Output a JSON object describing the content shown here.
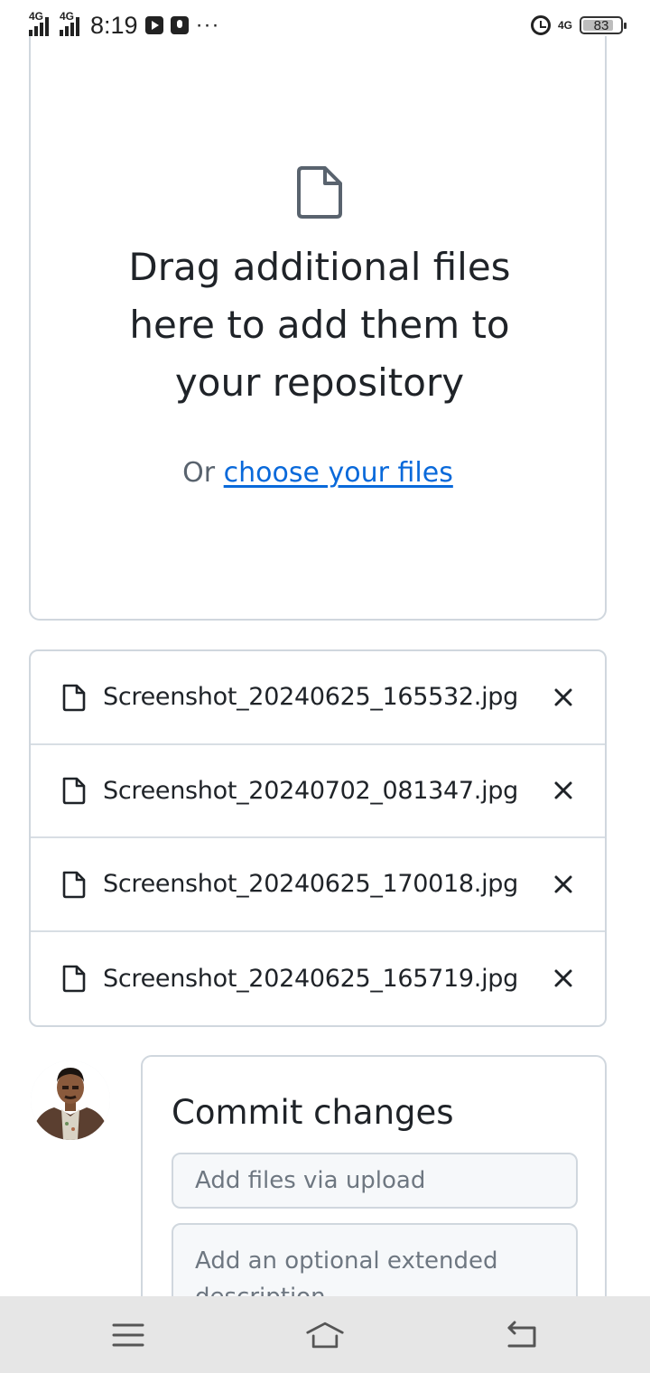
{
  "status_bar": {
    "network1": "4G",
    "network2": "4G",
    "time": "8:19",
    "more": "···",
    "network3": "4G",
    "battery": "83",
    "battery_level": 0.83
  },
  "dropzone": {
    "icon": "file-icon",
    "line1": "Drag additional files",
    "line2": "here to add them to",
    "line3": "your repository",
    "or_text": "Or",
    "choose_link": "choose your files"
  },
  "files": [
    {
      "name": "Screenshot_20240625_165532.jpg"
    },
    {
      "name": "Screenshot_20240702_081347.jpg"
    },
    {
      "name": "Screenshot_20240625_170018.jpg"
    },
    {
      "name": "Screenshot_20240625_165719.jpg"
    }
  ],
  "commit": {
    "title": "Commit changes",
    "summary_placeholder": "Add files via upload",
    "description_placeholder": "Add an optional extended description..."
  },
  "nav_bar": {
    "menu_icon": "menu-icon",
    "home_icon": "home-icon",
    "back_icon": "back-icon"
  }
}
